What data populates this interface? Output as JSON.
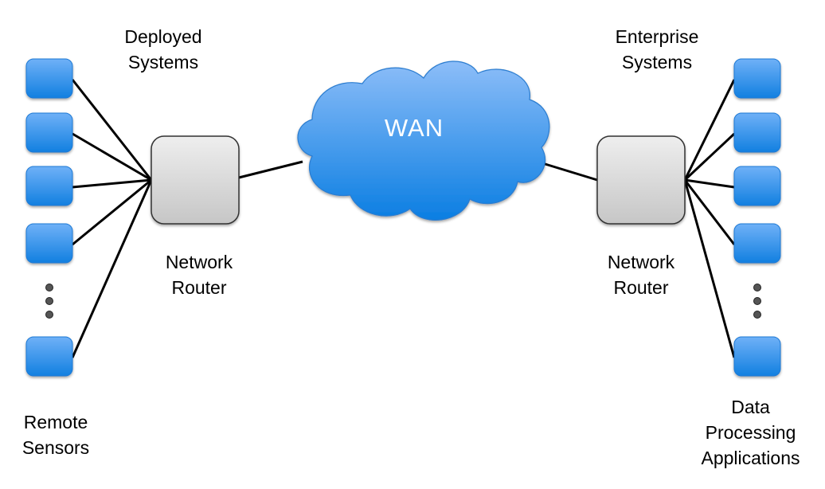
{
  "diagram": {
    "type": "network-topology",
    "cloud": {
      "label": "WAN",
      "color_top": "#8dbcf7",
      "color_bottom": "#0a7de0"
    },
    "left": {
      "group_label": [
        "Deployed",
        "Systems"
      ],
      "router_label": [
        "Network",
        "Router"
      ],
      "endpoints_label": [
        "Remote",
        "Sensors"
      ],
      "endpoint_count_shown": 5,
      "ellipsis": true
    },
    "right": {
      "group_label": [
        "Enterprise",
        "Systems"
      ],
      "router_label": [
        "Network",
        "Router"
      ],
      "endpoints_label": [
        "Data",
        "Processing",
        "Applications"
      ],
      "endpoint_count_shown": 5,
      "ellipsis": true
    },
    "colors": {
      "endpoint": "#2b8ef0",
      "router": "#d9d9d9",
      "link": "#000000"
    }
  }
}
